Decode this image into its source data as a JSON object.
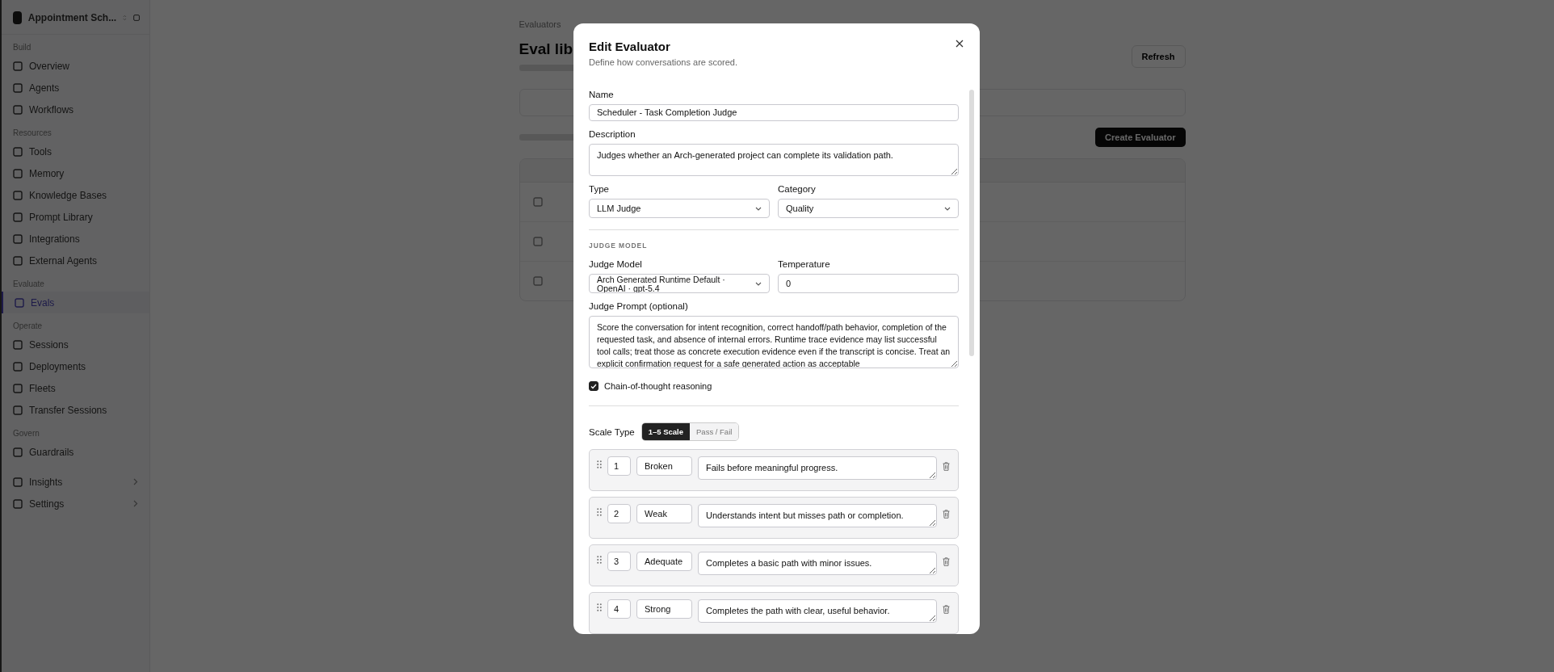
{
  "sidebar": {
    "workspace": "Appointment Sch...",
    "sections": [
      {
        "heading": "Build",
        "items": [
          {
            "label": "Overview",
            "selected": false,
            "has_submenu": false
          },
          {
            "label": "Agents",
            "selected": false,
            "has_submenu": false
          },
          {
            "label": "Workflows",
            "selected": false,
            "has_submenu": false
          }
        ]
      },
      {
        "heading": "Resources",
        "items": [
          {
            "label": "Tools",
            "selected": false,
            "has_submenu": false
          },
          {
            "label": "Memory",
            "selected": false,
            "has_submenu": false
          },
          {
            "label": "Knowledge Bases",
            "selected": false,
            "has_submenu": false
          },
          {
            "label": "Prompt Library",
            "selected": false,
            "has_submenu": false
          },
          {
            "label": "Integrations",
            "selected": false,
            "has_submenu": false
          },
          {
            "label": "External Agents",
            "selected": false,
            "has_submenu": false
          }
        ]
      },
      {
        "heading": "Evaluate",
        "items": [
          {
            "label": "Evals",
            "selected": true,
            "has_submenu": false
          }
        ]
      },
      {
        "heading": "Operate",
        "items": [
          {
            "label": "Sessions",
            "selected": false,
            "has_submenu": false
          },
          {
            "label": "Deployments",
            "selected": false,
            "has_submenu": false
          },
          {
            "label": "Fleets",
            "selected": false,
            "has_submenu": false
          },
          {
            "label": "Transfer Sessions",
            "selected": false,
            "has_submenu": false
          }
        ]
      },
      {
        "heading": "Govern",
        "items": [
          {
            "label": "Guardrails",
            "selected": false,
            "has_submenu": false
          }
        ]
      },
      {
        "items": [
          {
            "label": "Insights",
            "selected": false,
            "has_submenu": true
          },
          {
            "label": "Settings",
            "selected": false,
            "has_submenu": true
          }
        ]
      }
    ]
  },
  "page": {
    "breadcrumb": "Evaluators",
    "title": "Eval lib",
    "refresh_button": "Refresh",
    "create_button": "Create Evaluator"
  },
  "modal": {
    "title": "Edit Evaluator",
    "subtitle": "Define how conversations are scored.",
    "name": {
      "label": "Name",
      "value": "Scheduler - Task Completion Judge"
    },
    "description": {
      "label": "Description",
      "value": "Judges whether an Arch-generated project can complete its validation path."
    },
    "type": {
      "label": "Type",
      "value": "LLM Judge"
    },
    "category": {
      "label": "Category",
      "value": "Quality"
    },
    "section_heading": "JUDGE MODEL",
    "judge_model": {
      "label": "Judge Model",
      "value": "Arch Generated Runtime Default · OpenAI · gpt-5.4"
    },
    "temperature": {
      "label": "Temperature",
      "value": "0"
    },
    "judge_prompt": {
      "label": "Judge Prompt (optional)",
      "value": "Score the conversation for intent recognition, correct handoff/path behavior, completion of the requested task, and absence of internal errors. Runtime trace evidence may list successful tool calls; treat those as concrete execution evidence even if the transcript is concise. Treat an explicit confirmation request for a safe generated action as acceptable"
    },
    "chain_of_thought": {
      "label": "Chain-of-thought reasoning",
      "checked": true
    },
    "scale_type": {
      "label": "Scale Type",
      "options": [
        {
          "label": "1–5 Scale",
          "selected": true
        },
        {
          "label": "Pass / Fail",
          "selected": false
        }
      ]
    },
    "scale_rows": [
      {
        "score": "1",
        "label": "Broken",
        "description": "Fails before meaningful progress."
      },
      {
        "score": "2",
        "label": "Weak",
        "description": "Understands intent but misses path or completion."
      },
      {
        "score": "3",
        "label": "Adequate",
        "description": "Completes a basic path with minor issues."
      },
      {
        "score": "4",
        "label": "Strong",
        "description": "Completes the path with clear, useful behavior."
      }
    ]
  }
}
